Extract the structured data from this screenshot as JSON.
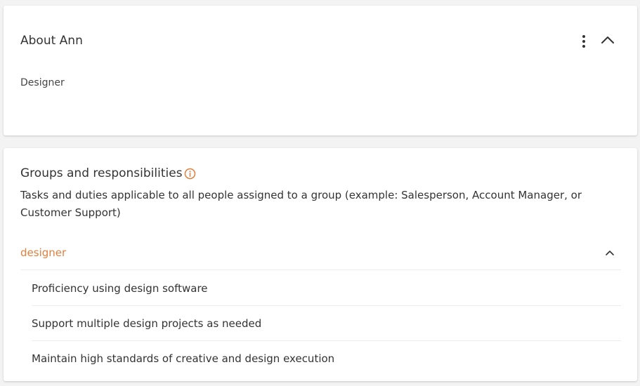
{
  "about": {
    "title": "About Ann",
    "role": "Designer",
    "menu_icon": "kebab-vertical-icon",
    "collapse_icon": "chevron-up-icon"
  },
  "groups": {
    "title": "Groups and responsibilities",
    "info_icon": "info-circle-icon",
    "description": "Tasks and duties applicable to all people assigned to a group (example: Salesperson, Account Manager, or Customer Support)",
    "items": [
      {
        "name": "designer",
        "expanded": true,
        "responsibilities": [
          "Proficiency using design software",
          "Support multiple design projects as needed",
          "Maintain high standards of creative and design execution"
        ]
      }
    ]
  },
  "colors": {
    "accent": "#e27f3c",
    "text": "#333333",
    "divider": "#ececec",
    "background": "#f3f3f3"
  }
}
